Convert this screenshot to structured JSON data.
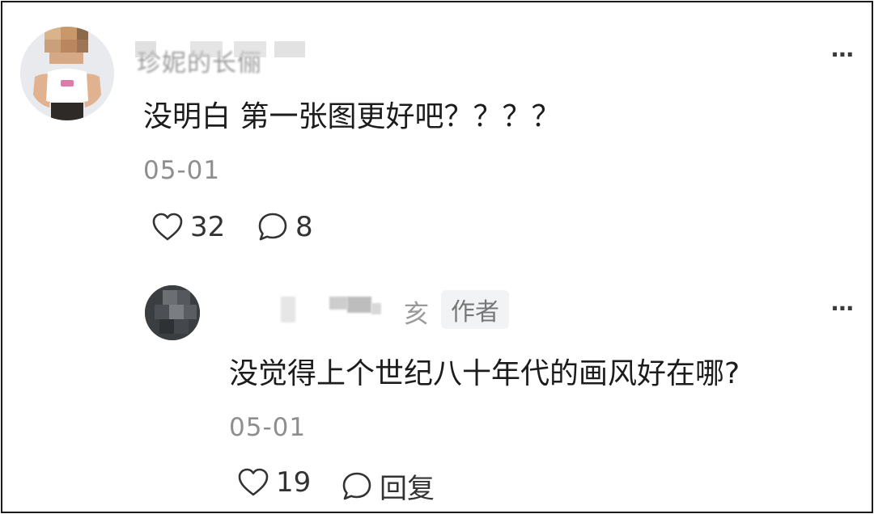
{
  "comment": {
    "username_blurred": "珍妮的长俪",
    "text": "没明白 第一张图更好吧？？？？",
    "date": "05-01",
    "likes": "32",
    "replies": "8",
    "more": "⋯"
  },
  "reply": {
    "username_visible_tail": "亥",
    "author_badge": "作者",
    "text": "没觉得上个世纪八十年代的画风好在哪?",
    "date": "05-01",
    "likes": "19",
    "reply_label": "回复",
    "more": "⋯"
  },
  "icons": {
    "like": "heart-outline-icon",
    "comment": "speech-bubble-icon",
    "more": "more-horizontal-icon"
  },
  "colors": {
    "text": "#1c1c1c",
    "muted": "#8e8e8e",
    "badge_bg": "#f2f3f5",
    "border": "#1a1a1a"
  }
}
